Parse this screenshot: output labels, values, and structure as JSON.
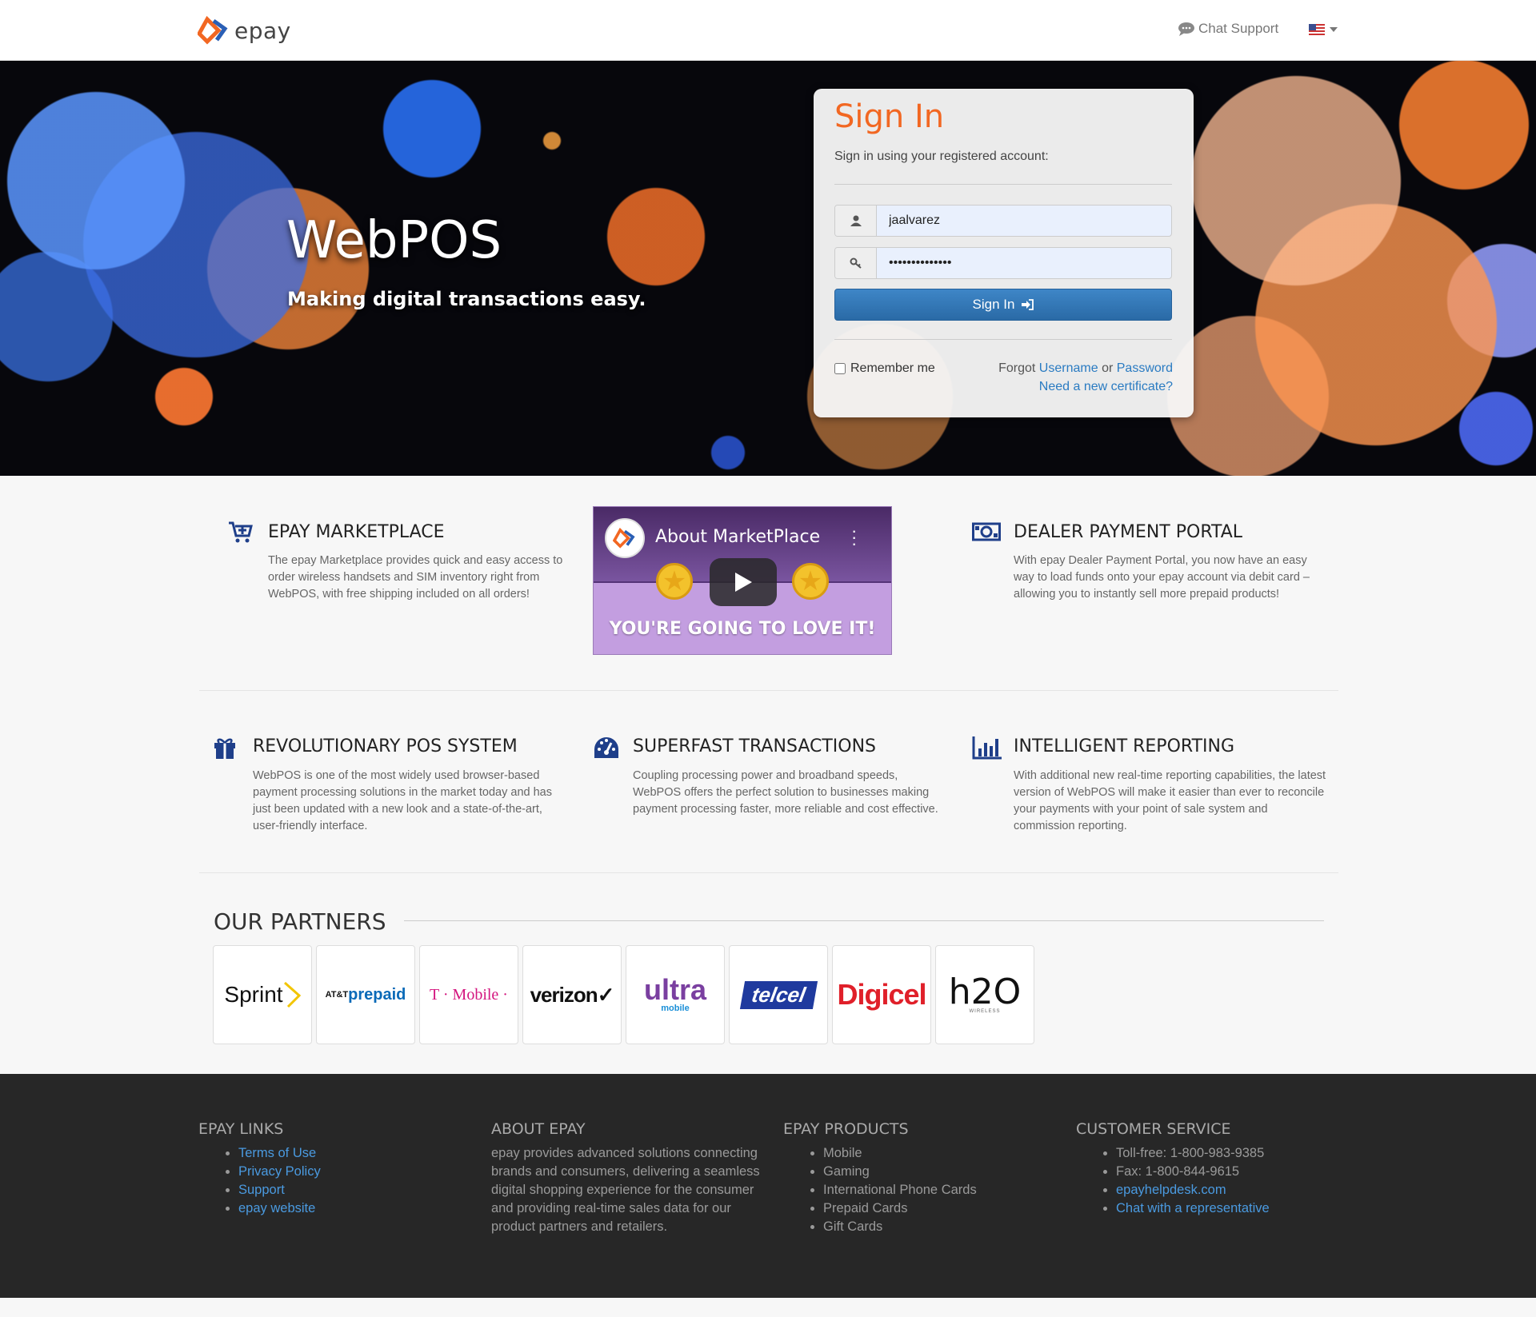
{
  "header": {
    "logo_text": "epay",
    "chat_support": "Chat Support",
    "language": "flag-us-icon"
  },
  "hero": {
    "title": "WebPOS",
    "subtitle": "Making digital transactions easy."
  },
  "signin": {
    "title": "Sign In",
    "subtitle": "Sign in using your registered account:",
    "username_value": "jaalvarez",
    "password_value": "••••••••••••••",
    "button_label": "Sign In",
    "remember_label": "Remember me",
    "forgot_prefix": "Forgot",
    "forgot_username": "Username",
    "forgot_or": "or",
    "forgot_password": "Password",
    "new_certificate": "Need a new certificate?"
  },
  "features": {
    "marketplace": {
      "title": "EPAY MARKETPLACE",
      "text": "The epay Marketplace provides quick and easy access to order wireless handsets and SIM inventory right from WebPOS, with free shipping included on all orders!",
      "icon": "cart-plus-icon"
    },
    "video": {
      "title": "About MarketPlace",
      "caption": "YOU'RE GOING TO LOVE IT!"
    },
    "dealer": {
      "title": "DEALER PAYMENT PORTAL",
      "text": "With epay Dealer Payment Portal, you now have an easy way to load funds onto your epay account via debit card – allowing you to instantly sell more prepaid products!",
      "icon": "money-icon"
    },
    "pos": {
      "title": "REVOLUTIONARY POS SYSTEM",
      "text": "WebPOS is one of the most widely used browser-based payment processing solutions in the market today and has just been updated with a new look and a state-of-the-art, user-friendly interface.",
      "icon": "gift-icon"
    },
    "superfast": {
      "title": "SUPERFAST TRANSACTIONS",
      "text": "Coupling processing power and broadband speeds, WebPOS offers the perfect solution to businesses making payment processing faster, more reliable and cost effective.",
      "icon": "dashboard-icon"
    },
    "reporting": {
      "title": "INTELLIGENT REPORTING",
      "text": "With additional new real-time reporting capabilities, the latest version of WebPOS will make it easier than ever to reconcile your payments with your point of sale system and commission reporting.",
      "icon": "bar-chart-icon"
    }
  },
  "partners": {
    "title": "OUR PARTNERS",
    "items": [
      {
        "name": "Sprint",
        "color": "#111111"
      },
      {
        "name_a": "AT&T",
        "name_b": "prepaid",
        "color": "#0a6ab8"
      },
      {
        "name": "T · Mobile ·",
        "color": "#d4157f"
      },
      {
        "name": "verizon✓",
        "color": "#111111"
      },
      {
        "name": "ultra",
        "sub": "mobile",
        "color": "#7a3fa0"
      },
      {
        "name": "telcel",
        "color": "#ffffff"
      },
      {
        "name": "Digicel",
        "color": "#e0202a"
      },
      {
        "name": "h2O",
        "sub": "WIRELESS",
        "color": "#111111"
      }
    ]
  },
  "footer": {
    "links_title": "EPAY LINKS",
    "links": [
      "Terms of Use",
      "Privacy Policy",
      "Support",
      "epay website"
    ],
    "about_title": "ABOUT EPAY",
    "about_text": "epay provides advanced solutions connecting brands and consumers, delivering a seamless digital shopping experience for the consumer and providing real-time sales data for our product partners and retailers.",
    "products_title": "EPAY PRODUCTS",
    "products": [
      "Mobile",
      "Gaming",
      "International Phone Cards",
      "Prepaid Cards",
      "Gift Cards"
    ],
    "service_title": "CUSTOMER SERVICE",
    "service": [
      "Toll-free: 1-800-983-9385",
      "Fax: 1-800-844-9615"
    ],
    "service_links": [
      "epayhelpdesk.com",
      "Chat with a representative"
    ]
  },
  "colors": {
    "accent_orange": "#f26722",
    "link_blue": "#2a7bc2",
    "button_blue": "#2a6aa6",
    "icon_navy": "#1f3f8a",
    "footer_bg": "#272727"
  }
}
